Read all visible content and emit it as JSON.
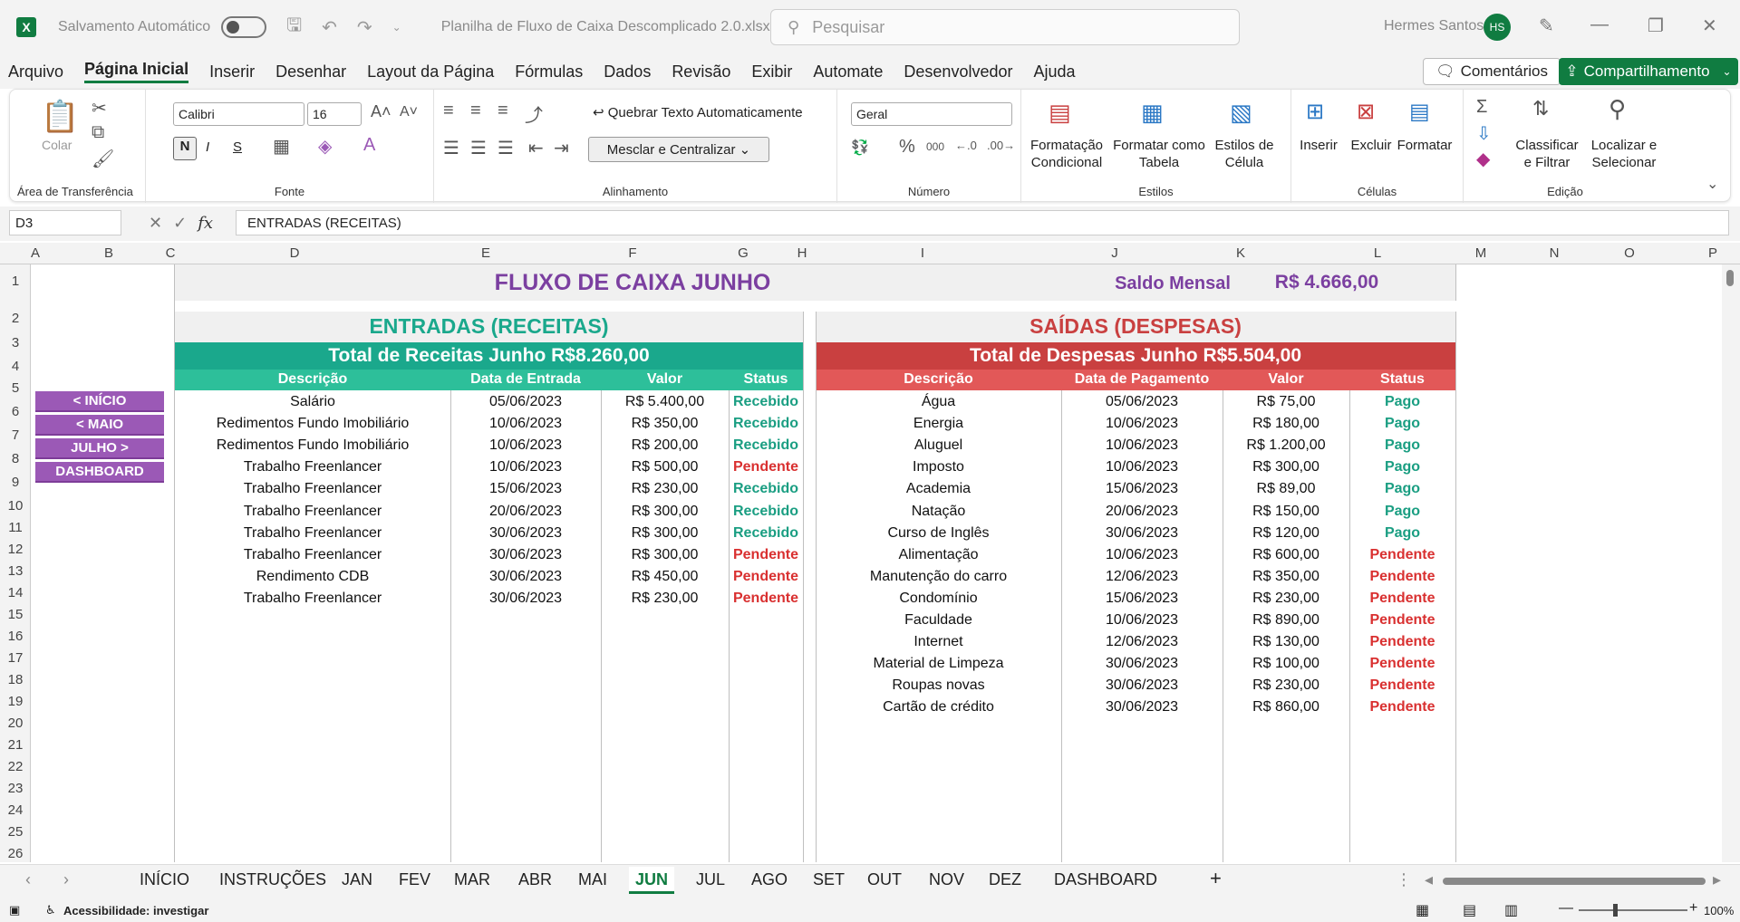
{
  "titlebar": {
    "autosave_label": "Salvamento Automático",
    "filename": "Planilha de Fluxo de Caixa Descomplicado 2.0.xlsx",
    "search_placeholder": "Pesquisar",
    "user_name": "Hermes Santos",
    "user_initials": "HS"
  },
  "menu": {
    "items": [
      "Arquivo",
      "Página Inicial",
      "Inserir",
      "Desenhar",
      "Layout da Página",
      "Fórmulas",
      "Dados",
      "Revisão",
      "Exibir",
      "Automate",
      "Desenvolvedor",
      "Ajuda"
    ],
    "active": "Página Inicial",
    "comments_label": "Comentários",
    "share_label": "Compartilhamento"
  },
  "ribbon": {
    "clipboard": {
      "paste": "Colar",
      "label": "Área de Transferência"
    },
    "font": {
      "name": "Calibri",
      "size": "16",
      "bold": "N",
      "italic": "I",
      "underline": "S",
      "label": "Fonte"
    },
    "alignment": {
      "wrap": "Quebrar Texto Automaticamente",
      "merge": "Mesclar e Centralizar",
      "label": "Alinhamento"
    },
    "number": {
      "format": "Geral",
      "label": "Número"
    },
    "styles": {
      "cond1": "Formatação",
      "cond2": "Condicional",
      "table1": "Formatar como",
      "table2": "Tabela",
      "cell1": "Estilos de",
      "cell2": "Célula",
      "label": "Estilos"
    },
    "cells": {
      "insert": "Inserir",
      "delete": "Excluir",
      "format": "Formatar",
      "label": "Células"
    },
    "editing": {
      "sort1": "Classificar",
      "sort2": "e Filtrar",
      "find1": "Localizar e",
      "find2": "Selecionar",
      "label": "Edição"
    }
  },
  "formula_bar": {
    "name_box": "D3",
    "content": "ENTRADAS (RECEITAS)"
  },
  "columns": [
    "A",
    "B",
    "C",
    "D",
    "E",
    "F",
    "G",
    "H",
    "I",
    "J",
    "K",
    "L",
    "M",
    "N",
    "O",
    "P"
  ],
  "rows": [
    "1",
    "2",
    "3",
    "4",
    "5",
    "6",
    "7",
    "8",
    "9",
    "10",
    "11",
    "12",
    "13",
    "14",
    "15",
    "16",
    "17",
    "18",
    "19",
    "20",
    "21",
    "22",
    "23",
    "24",
    "25",
    "26"
  ],
  "sheet": {
    "title": "FLUXO DE CAIXA JUNHO",
    "saldo_label": "Saldo Mensal",
    "saldo_value": "R$ 4.666,00",
    "nav_buttons": [
      "< INÍCIO",
      "< MAIO",
      "JULHO >",
      "DASHBOARD"
    ],
    "entradas": {
      "header": "ENTRADAS (RECEITAS)",
      "total": "Total de Receitas Junho R$8.260,00",
      "columns": [
        "Descrição",
        "Data de Entrada",
        "Valor",
        "Status"
      ],
      "rows": [
        [
          "Salário",
          "05/06/2023",
          "R$ 5.400,00",
          "Recebido"
        ],
        [
          "Redimentos Fundo Imobiliário",
          "10/06/2023",
          "R$ 350,00",
          "Recebido"
        ],
        [
          "Redimentos Fundo Imobiliário",
          "10/06/2023",
          "R$ 200,00",
          "Recebido"
        ],
        [
          "Trabalho Freenlancer",
          "10/06/2023",
          "R$ 500,00",
          "Pendente"
        ],
        [
          "Trabalho Freenlancer",
          "15/06/2023",
          "R$ 230,00",
          "Recebido"
        ],
        [
          "Trabalho Freenlancer",
          "20/06/2023",
          "R$ 300,00",
          "Recebido"
        ],
        [
          "Trabalho Freenlancer",
          "30/06/2023",
          "R$ 300,00",
          "Recebido"
        ],
        [
          "Trabalho Freenlancer",
          "30/06/2023",
          "R$ 300,00",
          "Pendente"
        ],
        [
          "Rendimento CDB",
          "30/06/2023",
          "R$ 450,00",
          "Pendente"
        ],
        [
          "Trabalho Freenlancer",
          "30/06/2023",
          "R$ 230,00",
          "Pendente"
        ]
      ]
    },
    "saidas": {
      "header": "SAÍDAS (DESPESAS)",
      "total": "Total de Despesas Junho R$5.504,00",
      "columns": [
        "Descrição",
        "Data de Pagamento",
        "Valor",
        "Status"
      ],
      "rows": [
        [
          "Água",
          "05/06/2023",
          "R$ 75,00",
          "Pago"
        ],
        [
          "Energia",
          "10/06/2023",
          "R$ 180,00",
          "Pago"
        ],
        [
          "Aluguel",
          "10/06/2023",
          "R$ 1.200,00",
          "Pago"
        ],
        [
          "Imposto",
          "10/06/2023",
          "R$ 300,00",
          "Pago"
        ],
        [
          "Academia",
          "15/06/2023",
          "R$ 89,00",
          "Pago"
        ],
        [
          "Natação",
          "20/06/2023",
          "R$ 150,00",
          "Pago"
        ],
        [
          "Curso de Inglês",
          "30/06/2023",
          "R$ 120,00",
          "Pago"
        ],
        [
          "Alimentação",
          "10/06/2023",
          "R$ 600,00",
          "Pendente"
        ],
        [
          "Manutenção do carro",
          "12/06/2023",
          "R$ 350,00",
          "Pendente"
        ],
        [
          "Condomínio",
          "15/06/2023",
          "R$ 230,00",
          "Pendente"
        ],
        [
          "Faculdade",
          "10/06/2023",
          "R$ 890,00",
          "Pendente"
        ],
        [
          "Internet",
          "12/06/2023",
          "R$ 130,00",
          "Pendente"
        ],
        [
          "Material de Limpeza",
          "30/06/2023",
          "R$ 100,00",
          "Pendente"
        ],
        [
          "Roupas novas",
          "30/06/2023",
          "R$ 230,00",
          "Pendente"
        ],
        [
          "Cartão de crédito",
          "30/06/2023",
          "R$ 860,00",
          "Pendente"
        ]
      ]
    },
    "colors": {
      "title": "#7b3fa0",
      "green": "#1aa88c",
      "green_light": "#2dbf9a",
      "red": "#c94040",
      "red_light": "#e25858",
      "purple": "#9b59b6",
      "status_green": "#1a9e82",
      "status_red": "#d93030"
    }
  },
  "tabs": [
    "INÍCIO",
    "INSTRUÇÕES",
    "JAN",
    "FEV",
    "MAR",
    "ABR",
    "MAI",
    "JUN",
    "JUL",
    "AGO",
    "SET",
    "OUT",
    "NOV",
    "DEZ",
    "DASHBOARD"
  ],
  "active_tab": "JUN",
  "statusbar": {
    "accessibility": "Acessibilidade: investigar",
    "zoom": "100%"
  }
}
